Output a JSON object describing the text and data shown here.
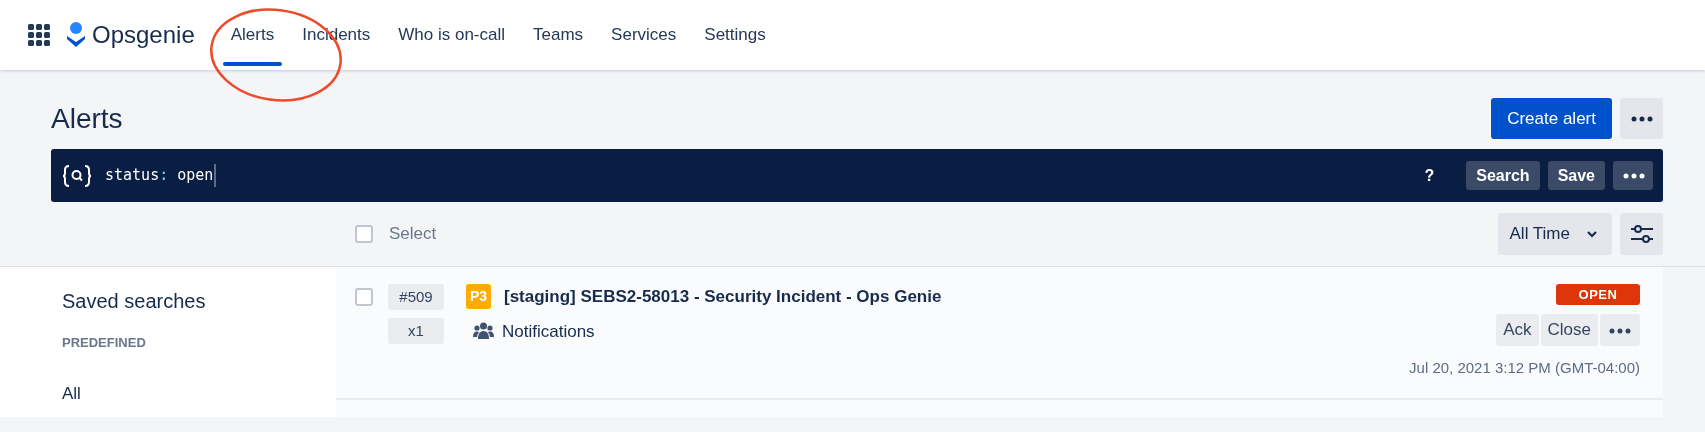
{
  "app": {
    "name": "Opsgenie"
  },
  "nav": [
    {
      "label": "Alerts",
      "selected": true
    },
    {
      "label": "Incidents",
      "selected": false
    },
    {
      "label": "Who is on-call",
      "selected": false
    },
    {
      "label": "Teams",
      "selected": false
    },
    {
      "label": "Services",
      "selected": false
    },
    {
      "label": "Settings",
      "selected": false
    }
  ],
  "page": {
    "title": "Alerts",
    "create_button": "Create alert"
  },
  "search": {
    "field": "status",
    "operator": ":",
    "value": "open",
    "help": "?",
    "buttons": [
      "Search",
      "Save"
    ]
  },
  "toolbar": {
    "select_label": "Select",
    "select_checked": false,
    "time_filter": "All Time"
  },
  "sidebar": {
    "title": "Saved searches",
    "section": "PREDEFINED",
    "items": [
      {
        "label": "All"
      }
    ]
  },
  "alerts": [
    {
      "checked": false,
      "number": "#509",
      "count": "x1",
      "priority": "P3",
      "title": "[staging] SEBS2-58013 - Security Incident - Ops Genie",
      "team": "Notifications",
      "status": "OPEN",
      "actions": [
        "Ack",
        "Close"
      ],
      "time": "Jul 20, 2021 3:12 PM (GMT-04:00)"
    }
  ]
}
